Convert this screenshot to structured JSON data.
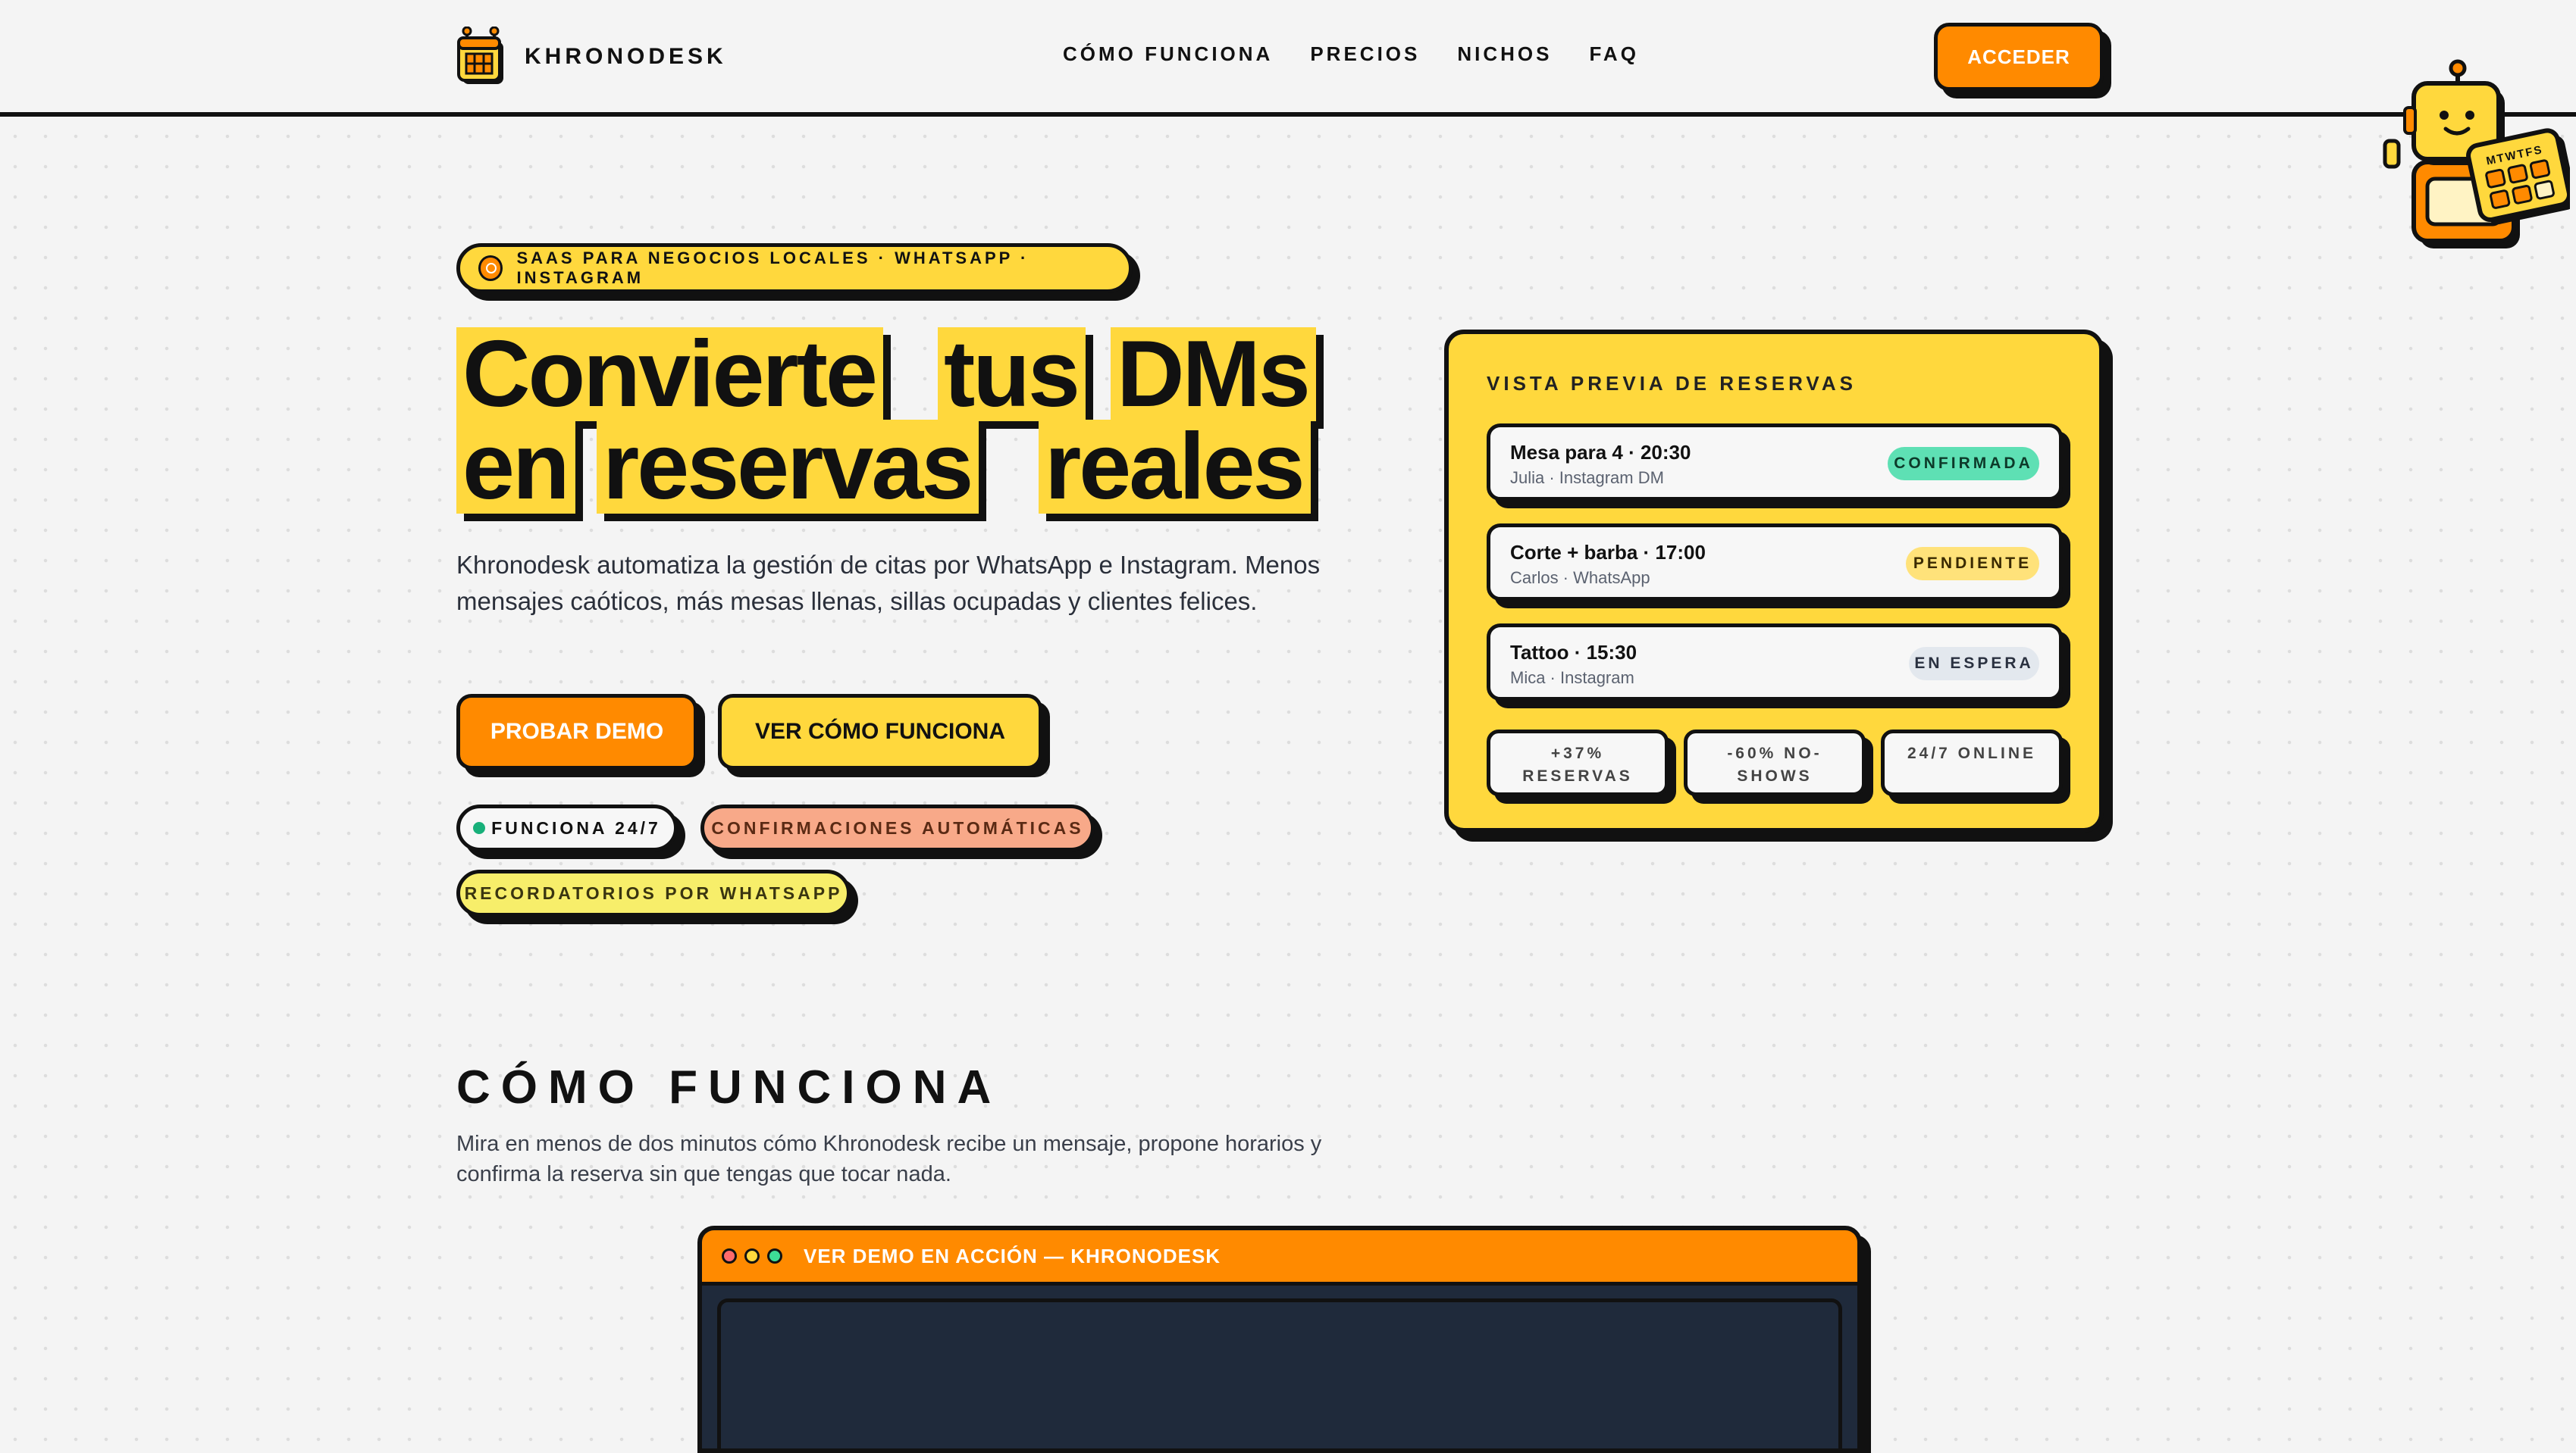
{
  "header": {
    "brand": "KHRONODESK",
    "nav": [
      "CÓMO FUNCIONA",
      "PRECIOS",
      "NICHOS",
      "FAQ"
    ],
    "cta": "ACCEDER"
  },
  "hero": {
    "eyebrow": "SAAS PARA NEGOCIOS LOCALES · WHATSAPP · INSTAGRAM",
    "headline_words": [
      "Convierte",
      "tus",
      "DMs",
      "en",
      "reservas",
      "reales"
    ],
    "description": "Khronodesk automatiza la gestión de citas por WhatsApp e Instagram. Menos mensajes caóticos, más mesas llenas, sillas ocupadas y clientes felices.",
    "primary_cta": "PROBAR DEMO",
    "secondary_cta": "VER CÓMO FUNCIONA",
    "chips": [
      "FUNCIONA 24/7",
      "CONFIRMACIONES AUTOMÁTICAS",
      "RECORDATORIOS POR WHATSAPP"
    ]
  },
  "preview": {
    "title": "VISTA PREVIA DE RESERVAS",
    "reservations": [
      {
        "title": "Mesa para 4 · 20:30",
        "subtitle": "Julia · Instagram DM",
        "status": "CONFIRMADA"
      },
      {
        "title": "Corte + barba · 17:00",
        "subtitle": "Carlos · WhatsApp",
        "status": "PENDIENTE"
      },
      {
        "title": "Tattoo · 15:30",
        "subtitle": "Mica · Instagram",
        "status": "EN ESPERA"
      }
    ],
    "stats": [
      {
        "line1": "+37%",
        "line2": "RESERVAS"
      },
      {
        "line1": "-60% NO-",
        "line2": "SHOWS"
      },
      {
        "line1": "24/7 ONLINE",
        "line2": ""
      }
    ]
  },
  "mascot": {
    "calendar_days": "MTWTFS"
  },
  "how": {
    "title": "CÓMO FUNCIONA",
    "description": "Mira en menos de dos minutos cómo Khronodesk recibe un mensaje, propone horarios y confirma la reserva sin que tengas que tocar nada.",
    "demo_window_title": "VER DEMO EN ACCIÓN — KHRONODESK"
  },
  "colors": {
    "accent_orange": "#ff8a00",
    "accent_yellow": "#ffd83d",
    "ink": "#111111",
    "confirmed": "#5ee0b4",
    "pending": "#ffe27a",
    "waiting": "#e3e8ee",
    "chip_salmon": "#f8a989",
    "chip_lemon": "#f7ee6a"
  }
}
